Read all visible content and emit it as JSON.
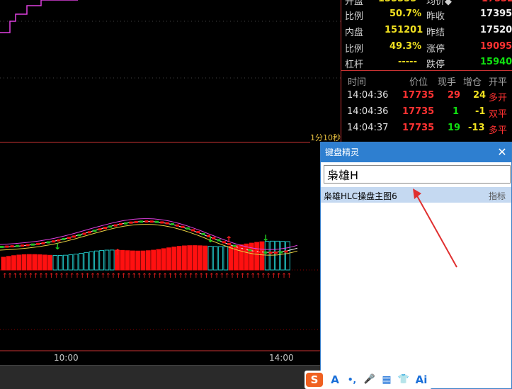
{
  "quote": {
    "rows": [
      {
        "l1": "比例",
        "v1": "50.7%",
        "l2": "昨收",
        "v2": "17395"
      },
      {
        "l1": "内盘",
        "v1": "151201",
        "l2": "昨结",
        "v2": "17520"
      },
      {
        "l1": "比例",
        "v1": "49.3%",
        "l2": "涨停",
        "v2": "19095"
      },
      {
        "l1": "杠杆",
        "v1": "-----",
        "l2": "跌停",
        "v2": "15940"
      }
    ],
    "tick_headers": {
      "time": "时间",
      "price": "价位",
      "qty": "现手",
      "oi": "增仓",
      "type": "开平"
    },
    "ticks": [
      {
        "time": "14:04:36",
        "price": "17735",
        "qty": "29",
        "oi": "24",
        "type": "多开"
      },
      {
        "time": "14:04:36",
        "price": "17735",
        "qty": "1",
        "oi": "-1",
        "type": "双平"
      },
      {
        "time": "14:04:37",
        "price": "17735",
        "qty": "19",
        "oi": "-13",
        "type": "多平"
      }
    ]
  },
  "chart": {
    "timeframe": "1分10秒",
    "time_labels": [
      "10:00",
      "14:00"
    ],
    "colors": {
      "up": "#ff1010",
      "down": "#20c0c0",
      "arrow_up": "#ff2020",
      "arrow_down": "#20d020",
      "grid": "#8b0000"
    }
  },
  "kb_wizard": {
    "title": "键盘精灵",
    "close": "✕",
    "input_value": "枭雄H",
    "result_name": "枭雄HLC操盘主图6",
    "result_type": "指标"
  },
  "ime": {
    "items": [
      "S",
      "A",
      "•,",
      "🎤",
      "▦",
      "👕",
      "Ai"
    ]
  }
}
